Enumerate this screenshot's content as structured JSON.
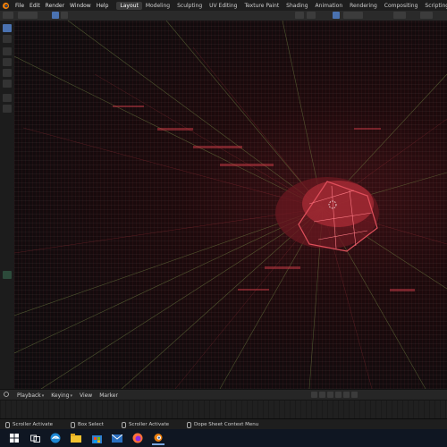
{
  "menu": {
    "items": [
      "File",
      "Edit",
      "Render",
      "Window",
      "Help"
    ]
  },
  "workspaces": {
    "tabs": [
      "Layout",
      "Modeling",
      "Sculpting",
      "UV Editing",
      "Texture Paint",
      "Shading",
      "Animation",
      "Rendering",
      "Compositing",
      "Scripting"
    ],
    "active": "Layout",
    "add_label": "+"
  },
  "timeline": {
    "playback_label": "Playback",
    "keying_label": "Keying",
    "view_label": "View",
    "marker_label": "Marker"
  },
  "status": {
    "items": [
      "Scroller Activate",
      "Box Select",
      "Scroller Activate",
      "Dope Sheet Context Menu"
    ]
  },
  "taskbar": {
    "icons": [
      "start-icon",
      "task-view-icon",
      "edge-browser-icon",
      "file-explorer-icon",
      "store-icon",
      "mail-icon",
      "firefox-icon",
      "blender-icon"
    ]
  },
  "colors": {
    "accent": "#3a3a3a",
    "mesh_red": "#c83a45",
    "grid_green": "#7a8f4a",
    "taskbar": "#0f1622"
  }
}
